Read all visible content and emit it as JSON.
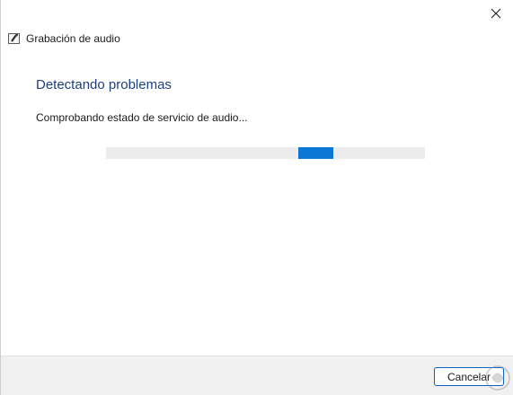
{
  "window": {
    "title": "Grabación de audio",
    "close_icon": "close-icon",
    "app_icon": "audio-troubleshooter-icon"
  },
  "main": {
    "heading": "Detectando problemas",
    "status_text": "Comprobando estado de servicio de audio...",
    "progress": "indeterminate"
  },
  "footer": {
    "cancel_label": "Cancelar"
  },
  "colors": {
    "heading": "#1e3f80",
    "progress_fill": "#0a78d4",
    "progress_track": "#ececec",
    "button_border": "#0a64c8",
    "footer_bg": "#f0f0f0"
  }
}
